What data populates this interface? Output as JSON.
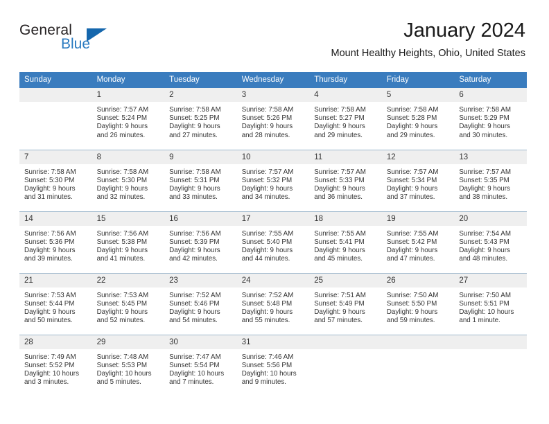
{
  "brand": {
    "name_part1": "General",
    "name_part2": "Blue",
    "logo_icon": "blue-triangle-icon"
  },
  "header": {
    "month_title": "January 2024",
    "location": "Mount Healthy Heights, Ohio, United States"
  },
  "colors": {
    "header_blue": "#3a7cbe",
    "brand_blue": "#2a7ac0",
    "logo_triangle": "#1567ad",
    "daynum_band": "#efefef",
    "row_divider": "#9fb8cd",
    "text": "#333333"
  },
  "weekdays": [
    "Sunday",
    "Monday",
    "Tuesday",
    "Wednesday",
    "Thursday",
    "Friday",
    "Saturday"
  ],
  "weeks": [
    [
      {
        "day": "",
        "sunrise": "",
        "sunset": "",
        "daylight1": "",
        "daylight2": "",
        "empty": true
      },
      {
        "day": "1",
        "sunrise": "Sunrise: 7:57 AM",
        "sunset": "Sunset: 5:24 PM",
        "daylight1": "Daylight: 9 hours",
        "daylight2": "and 26 minutes."
      },
      {
        "day": "2",
        "sunrise": "Sunrise: 7:58 AM",
        "sunset": "Sunset: 5:25 PM",
        "daylight1": "Daylight: 9 hours",
        "daylight2": "and 27 minutes."
      },
      {
        "day": "3",
        "sunrise": "Sunrise: 7:58 AM",
        "sunset": "Sunset: 5:26 PM",
        "daylight1": "Daylight: 9 hours",
        "daylight2": "and 28 minutes."
      },
      {
        "day": "4",
        "sunrise": "Sunrise: 7:58 AM",
        "sunset": "Sunset: 5:27 PM",
        "daylight1": "Daylight: 9 hours",
        "daylight2": "and 29 minutes."
      },
      {
        "day": "5",
        "sunrise": "Sunrise: 7:58 AM",
        "sunset": "Sunset: 5:28 PM",
        "daylight1": "Daylight: 9 hours",
        "daylight2": "and 29 minutes."
      },
      {
        "day": "6",
        "sunrise": "Sunrise: 7:58 AM",
        "sunset": "Sunset: 5:29 PM",
        "daylight1": "Daylight: 9 hours",
        "daylight2": "and 30 minutes."
      }
    ],
    [
      {
        "day": "7",
        "sunrise": "Sunrise: 7:58 AM",
        "sunset": "Sunset: 5:30 PM",
        "daylight1": "Daylight: 9 hours",
        "daylight2": "and 31 minutes."
      },
      {
        "day": "8",
        "sunrise": "Sunrise: 7:58 AM",
        "sunset": "Sunset: 5:30 PM",
        "daylight1": "Daylight: 9 hours",
        "daylight2": "and 32 minutes."
      },
      {
        "day": "9",
        "sunrise": "Sunrise: 7:58 AM",
        "sunset": "Sunset: 5:31 PM",
        "daylight1": "Daylight: 9 hours",
        "daylight2": "and 33 minutes."
      },
      {
        "day": "10",
        "sunrise": "Sunrise: 7:57 AM",
        "sunset": "Sunset: 5:32 PM",
        "daylight1": "Daylight: 9 hours",
        "daylight2": "and 34 minutes."
      },
      {
        "day": "11",
        "sunrise": "Sunrise: 7:57 AM",
        "sunset": "Sunset: 5:33 PM",
        "daylight1": "Daylight: 9 hours",
        "daylight2": "and 36 minutes."
      },
      {
        "day": "12",
        "sunrise": "Sunrise: 7:57 AM",
        "sunset": "Sunset: 5:34 PM",
        "daylight1": "Daylight: 9 hours",
        "daylight2": "and 37 minutes."
      },
      {
        "day": "13",
        "sunrise": "Sunrise: 7:57 AM",
        "sunset": "Sunset: 5:35 PM",
        "daylight1": "Daylight: 9 hours",
        "daylight2": "and 38 minutes."
      }
    ],
    [
      {
        "day": "14",
        "sunrise": "Sunrise: 7:56 AM",
        "sunset": "Sunset: 5:36 PM",
        "daylight1": "Daylight: 9 hours",
        "daylight2": "and 39 minutes."
      },
      {
        "day": "15",
        "sunrise": "Sunrise: 7:56 AM",
        "sunset": "Sunset: 5:38 PM",
        "daylight1": "Daylight: 9 hours",
        "daylight2": "and 41 minutes."
      },
      {
        "day": "16",
        "sunrise": "Sunrise: 7:56 AM",
        "sunset": "Sunset: 5:39 PM",
        "daylight1": "Daylight: 9 hours",
        "daylight2": "and 42 minutes."
      },
      {
        "day": "17",
        "sunrise": "Sunrise: 7:55 AM",
        "sunset": "Sunset: 5:40 PM",
        "daylight1": "Daylight: 9 hours",
        "daylight2": "and 44 minutes."
      },
      {
        "day": "18",
        "sunrise": "Sunrise: 7:55 AM",
        "sunset": "Sunset: 5:41 PM",
        "daylight1": "Daylight: 9 hours",
        "daylight2": "and 45 minutes."
      },
      {
        "day": "19",
        "sunrise": "Sunrise: 7:55 AM",
        "sunset": "Sunset: 5:42 PM",
        "daylight1": "Daylight: 9 hours",
        "daylight2": "and 47 minutes."
      },
      {
        "day": "20",
        "sunrise": "Sunrise: 7:54 AM",
        "sunset": "Sunset: 5:43 PM",
        "daylight1": "Daylight: 9 hours",
        "daylight2": "and 48 minutes."
      }
    ],
    [
      {
        "day": "21",
        "sunrise": "Sunrise: 7:53 AM",
        "sunset": "Sunset: 5:44 PM",
        "daylight1": "Daylight: 9 hours",
        "daylight2": "and 50 minutes."
      },
      {
        "day": "22",
        "sunrise": "Sunrise: 7:53 AM",
        "sunset": "Sunset: 5:45 PM",
        "daylight1": "Daylight: 9 hours",
        "daylight2": "and 52 minutes."
      },
      {
        "day": "23",
        "sunrise": "Sunrise: 7:52 AM",
        "sunset": "Sunset: 5:46 PM",
        "daylight1": "Daylight: 9 hours",
        "daylight2": "and 54 minutes."
      },
      {
        "day": "24",
        "sunrise": "Sunrise: 7:52 AM",
        "sunset": "Sunset: 5:48 PM",
        "daylight1": "Daylight: 9 hours",
        "daylight2": "and 55 minutes."
      },
      {
        "day": "25",
        "sunrise": "Sunrise: 7:51 AM",
        "sunset": "Sunset: 5:49 PM",
        "daylight1": "Daylight: 9 hours",
        "daylight2": "and 57 minutes."
      },
      {
        "day": "26",
        "sunrise": "Sunrise: 7:50 AM",
        "sunset": "Sunset: 5:50 PM",
        "daylight1": "Daylight: 9 hours",
        "daylight2": "and 59 minutes."
      },
      {
        "day": "27",
        "sunrise": "Sunrise: 7:50 AM",
        "sunset": "Sunset: 5:51 PM",
        "daylight1": "Daylight: 10 hours",
        "daylight2": "and 1 minute."
      }
    ],
    [
      {
        "day": "28",
        "sunrise": "Sunrise: 7:49 AM",
        "sunset": "Sunset: 5:52 PM",
        "daylight1": "Daylight: 10 hours",
        "daylight2": "and 3 minutes."
      },
      {
        "day": "29",
        "sunrise": "Sunrise: 7:48 AM",
        "sunset": "Sunset: 5:53 PM",
        "daylight1": "Daylight: 10 hours",
        "daylight2": "and 5 minutes."
      },
      {
        "day": "30",
        "sunrise": "Sunrise: 7:47 AM",
        "sunset": "Sunset: 5:54 PM",
        "daylight1": "Daylight: 10 hours",
        "daylight2": "and 7 minutes."
      },
      {
        "day": "31",
        "sunrise": "Sunrise: 7:46 AM",
        "sunset": "Sunset: 5:56 PM",
        "daylight1": "Daylight: 10 hours",
        "daylight2": "and 9 minutes."
      },
      {
        "day": "",
        "sunrise": "",
        "sunset": "",
        "daylight1": "",
        "daylight2": "",
        "empty": true
      },
      {
        "day": "",
        "sunrise": "",
        "sunset": "",
        "daylight1": "",
        "daylight2": "",
        "empty": true
      },
      {
        "day": "",
        "sunrise": "",
        "sunset": "",
        "daylight1": "",
        "daylight2": "",
        "empty": true
      }
    ]
  ]
}
